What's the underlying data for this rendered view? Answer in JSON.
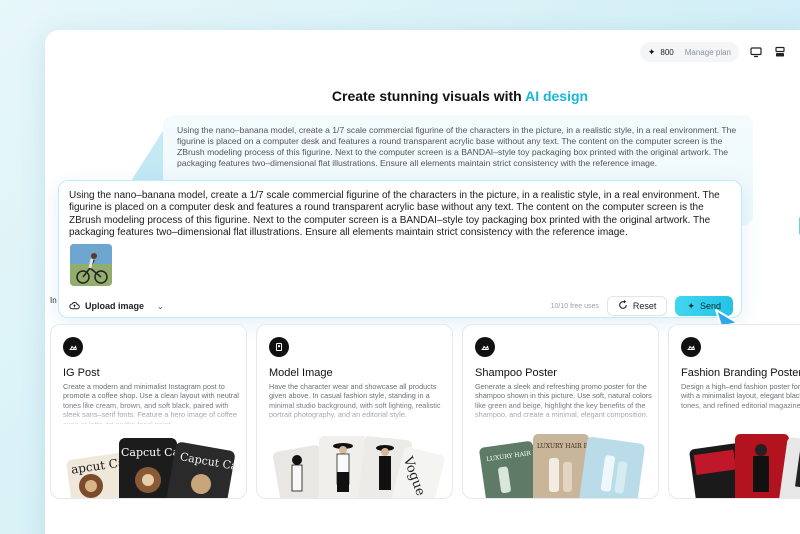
{
  "topbar": {
    "credits": "800",
    "manage_plan": "Manage plan"
  },
  "headline": {
    "prefix": "Create stunning visuals with ",
    "accent": "AI design"
  },
  "prompt": {
    "text": "Using the nano–banana model, create a 1/7 scale commercial figurine of the characters in the picture, in a realistic style, in a real environment. The figurine is placed on a computer desk and features a round transparent acrylic base without any text. The content on the computer screen is the ZBrush modeling process of this figurine. Next to the computer screen is a BANDAI–style toy packaging box printed with the original artwork. The packaging features two–dimensional flat illustrations. Ensure all elements maintain strict consistency with the reference image.",
    "upload_label": "Upload image",
    "uses": "10/10 free uses",
    "reset_label": "Reset",
    "send_label": "Send"
  },
  "tab_partial": "In",
  "cards": [
    {
      "title": "IG Post",
      "desc": "Create a modern and minimalist Instagram post to promote a coffee shop. Use a clean layout with neutral tones like cream, brown, and soft black, paired with sleek sans–serif fonts. Feature a hero image of coffee cups or latte art as the focal point.",
      "brand_a": "apcut Ca",
      "brand_b": "Capcut Caf",
      "brand_c": "Capcut Caf"
    },
    {
      "title": "Model Image",
      "desc": "Have the character wear and showcase all products given above. In casual fashion style, standing in a minimal studio background, with soft lighting, realistic portrait photography, and an editorial style.",
      "brand_a": "Vogue",
      "brand_b": "Vogue"
    },
    {
      "title": "Shampoo Poster",
      "desc": "Generate a sleek and refreshing promo poster for the shampoo shown in this picture. Use soft, natural colors like green and beige, highlight the key benefits of the shampoo, and create a minimal, elegant composition.",
      "brand_a": "LUXURY HAIR ESSENCE",
      "brand_b": "LUXURY HAIR ESSENCE"
    },
    {
      "title": "Fashion Branding Poster",
      "desc": "Design a high–end fashion poster for a clothing brand with a minimalist layout, elegant black, white, and red tones, and refined editorial magazine aesthetics.",
      "brand_a": ""
    }
  ],
  "colors": {
    "accent": "#18b7d9",
    "send": "#2cc8ea"
  }
}
